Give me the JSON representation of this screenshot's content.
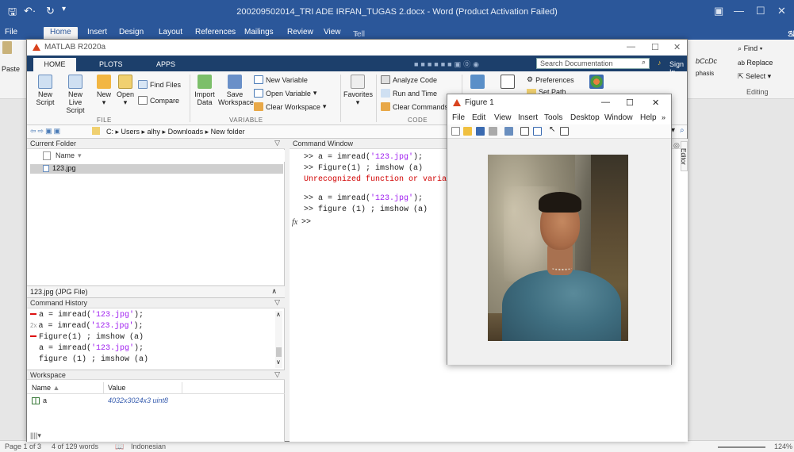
{
  "word": {
    "title": "200209502014_TRI ADE IRFAN_TUGAS 2.docx - Word (Product Activation Failed)",
    "tabs": [
      "File",
      "Home",
      "Insert",
      "Design",
      "Layout",
      "References",
      "Mailings",
      "Review",
      "View"
    ],
    "tell_me": "Tell me what you want to do...",
    "share": "Share",
    "paste": "Paste",
    "find": "Find",
    "replace": "Replace",
    "select": "Select",
    "editing": "Editing",
    "style_fragment": "bCcDc",
    "emphasis_fragment": "phasis",
    "status": {
      "page": "Page 1 of 3",
      "words": "4 of 129 words",
      "language": "Indonesian",
      "zoom": "124%"
    }
  },
  "matlab": {
    "title": "MATLAB R2020a",
    "tabs": {
      "home": "HOME",
      "plots": "PLOTS",
      "apps": "APPS"
    },
    "search_placeholder": "Search Documentation",
    "sign_in": "Sign In",
    "ribbon": {
      "new_script": "New\nScript",
      "new_live_script": "New\nLive Script",
      "new": "New",
      "open": "Open",
      "find_files": "Find Files",
      "compare": "Compare",
      "import_data": "Import\nData",
      "save_workspace": "Save\nWorkspace",
      "new_variable": "New Variable",
      "open_variable": "Open Variable",
      "clear_workspace": "Clear Workspace",
      "favorites": "Favorites",
      "analyze_code": "Analyze Code",
      "run_and_time": "Run and Time",
      "clear_commands": "Clear Commands",
      "preferences": "Preferences",
      "set_path": "Set Path",
      "groups": {
        "file": "FILE",
        "variable": "VARIABLE",
        "code": "CODE"
      }
    },
    "address": {
      "path": "C: ▸ Users ▸ alhy ▸ Downloads ▸ New folder"
    },
    "current_folder": {
      "title": "Current Folder",
      "column": "Name",
      "files": [
        "123.jpg"
      ],
      "detail": "123.jpg (JPG File)"
    },
    "command_history": {
      "title": "Command History",
      "lines": [
        {
          "pre": "",
          "code": "a = imread(",
          "str": "'123.jpg'",
          "end": ");",
          "marker": true
        },
        {
          "pre": "2x",
          "code": "a = imread(",
          "str": "'123.jpg'",
          "end": ");",
          "marker": false
        },
        {
          "pre": "",
          "code": "Figure(1) ; imshow (a)",
          "str": "",
          "end": "",
          "marker": true
        },
        {
          "pre": "",
          "code": "a = imread(",
          "str": "'123.jpg'",
          "end": ");",
          "marker": false
        },
        {
          "pre": "",
          "code": "figure (1) ; imshow (a)",
          "str": "",
          "end": "",
          "marker": false
        }
      ]
    },
    "workspace": {
      "title": "Workspace",
      "col_name": "Name",
      "col_value": "Value",
      "vars": [
        {
          "name": "a",
          "value": "4032x3024x3 uint8"
        }
      ]
    },
    "command_window": {
      "title": "Command Window",
      "lines": [
        {
          "prompt": ">> ",
          "code": "a = imread(",
          "str": "'123.jpg'",
          "end": ");"
        },
        {
          "prompt": ">> ",
          "code": "Figure(1) ; imshow (a)",
          "str": "",
          "end": ""
        },
        {
          "error": "Unrecognized function or variab"
        },
        {
          "prompt": ">> ",
          "code": "a = imread(",
          "str": "'123.jpg'",
          "end": ");"
        },
        {
          "prompt": ">> ",
          "code": "figure (1) ; imshow (a)",
          "str": "",
          "end": ""
        }
      ],
      "fx": "fx",
      "current_prompt": ">>"
    },
    "editor_side": "Editor"
  },
  "figure": {
    "title": "Figure 1",
    "menu": [
      "File",
      "Edit",
      "View",
      "Insert",
      "Tools",
      "Desktop",
      "Window",
      "Help"
    ]
  },
  "colors": {
    "word_blue": "#2b579a",
    "matlab_tab": "#1c3f6b",
    "error": "#d10000",
    "string": "#a020f0"
  }
}
